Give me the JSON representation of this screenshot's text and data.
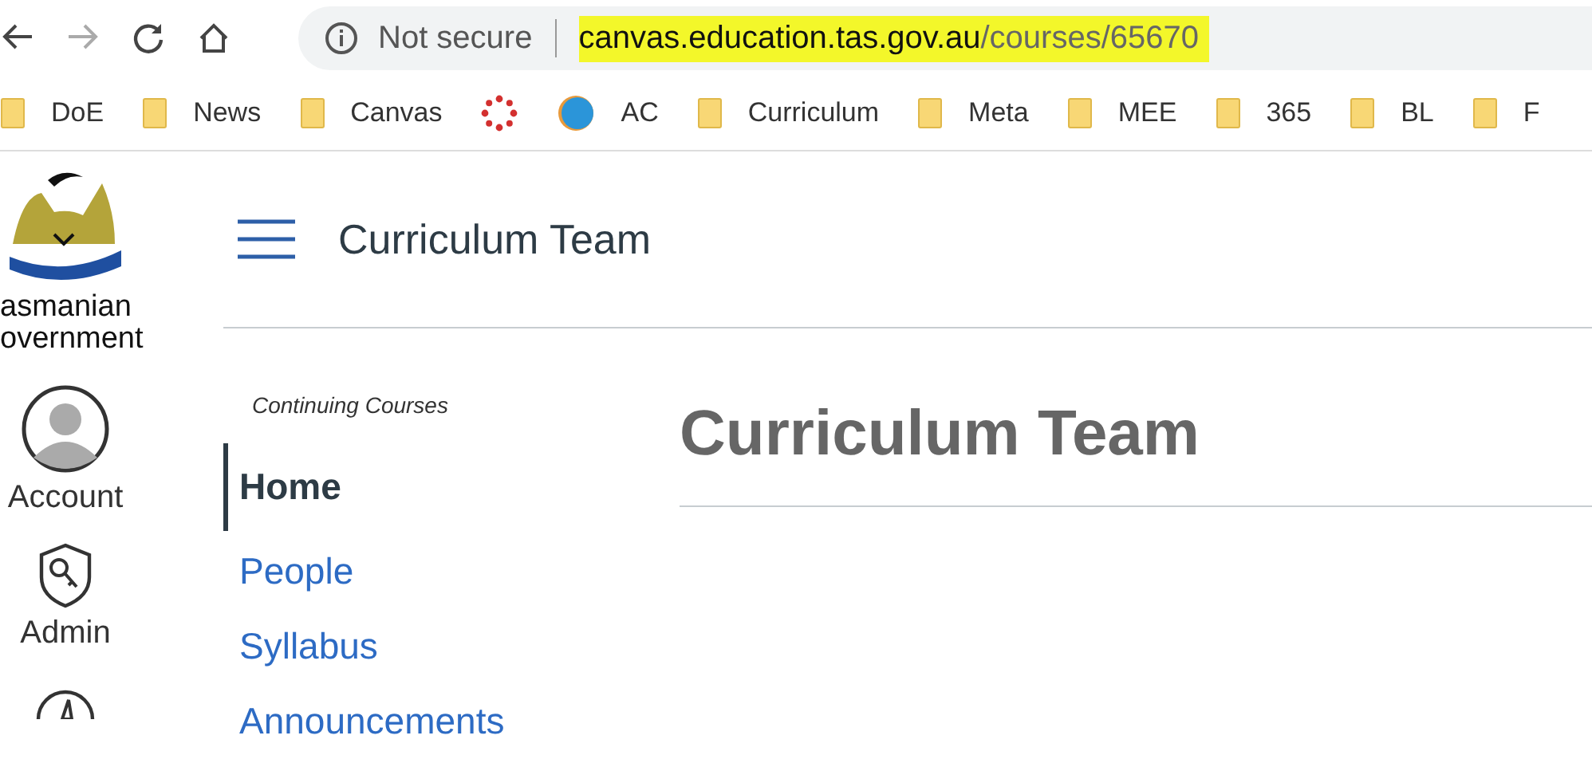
{
  "browser": {
    "buttons": [
      {
        "kind": "back",
        "disabled": false
      },
      {
        "kind": "forward",
        "disabled": true
      },
      {
        "kind": "reload",
        "disabled": false
      },
      {
        "kind": "home",
        "disabled": false
      }
    ],
    "address": {
      "security": "Not secure",
      "host": "canvas.education.tas.gov.au",
      "path": "/courses/65670",
      "highlighted": true
    },
    "bookmarks": [
      {
        "kind": "folder",
        "label": "DoE"
      },
      {
        "kind": "folder",
        "label": "News"
      },
      {
        "kind": "folder",
        "label": "Canvas"
      },
      {
        "kind": "canvas"
      },
      {
        "kind": "ac",
        "label": "AC"
      },
      {
        "kind": "folder",
        "label": "Curriculum"
      },
      {
        "kind": "folder",
        "label": "Meta"
      },
      {
        "kind": "folder",
        "label": "MEE"
      },
      {
        "kind": "folder",
        "label": "365"
      },
      {
        "kind": "folder",
        "label": "BL"
      },
      {
        "kind": "folder",
        "label": "F"
      }
    ]
  },
  "global_nav": {
    "logo_lines": [
      "asmanian",
      "overnment"
    ],
    "items": [
      {
        "kind": "account",
        "label": "Account"
      },
      {
        "kind": "admin",
        "label": "Admin"
      },
      {
        "kind": "dashboard"
      }
    ]
  },
  "course": {
    "title": "Curriculum Team",
    "subaccount": "Continuing Courses",
    "nav": [
      {
        "label": "Home",
        "selected": true
      },
      {
        "label": "People",
        "selected": false
      },
      {
        "label": "Syllabus",
        "selected": false
      },
      {
        "label": "Announcements",
        "selected": false
      }
    ],
    "heading": "Curriculum Team"
  }
}
